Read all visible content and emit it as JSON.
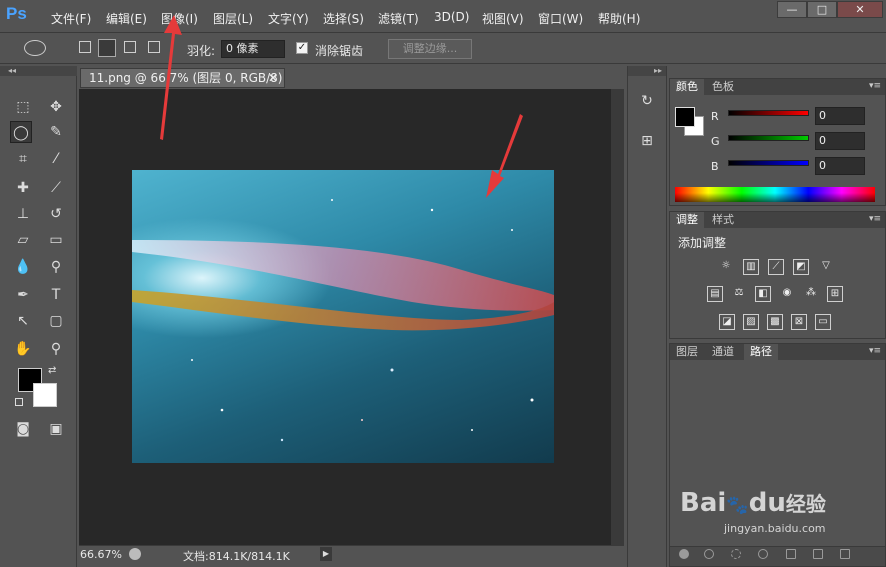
{
  "app": {
    "logo": "Ps"
  },
  "menu": [
    "文件(F)",
    "编辑(E)",
    "图像(I)",
    "图层(L)",
    "文字(Y)",
    "选择(S)",
    "滤镜(T)",
    "3D(D)",
    "视图(V)",
    "窗口(W)",
    "帮助(H)"
  ],
  "window_controls": {
    "minimize": "—",
    "restore": "□",
    "close": "✕"
  },
  "options": {
    "feather_label": "羽化:",
    "feather_value": "0 像素",
    "antialias_label": "消除锯齿",
    "antialias_checked": true,
    "refine_edge_label": "调整边缘..."
  },
  "document": {
    "tab_title": "11.png @ 66.7% (图层 0, RGB/8)",
    "tab_close": "✕",
    "zoom": "66.67%",
    "doc_info": "文档:814.1K/814.1K"
  },
  "color_panel": {
    "tabs": [
      "颜色",
      "色板"
    ],
    "active_tab": "颜色",
    "channels": [
      {
        "label": "R",
        "value": "0",
        "color": "#ff0000"
      },
      {
        "label": "G",
        "value": "0",
        "color": "#00cc00"
      },
      {
        "label": "B",
        "value": "0",
        "color": "#0000ff"
      }
    ],
    "foreground": "#000000",
    "background": "#ffffff"
  },
  "adjustments_panel": {
    "tabs": [
      "调整",
      "样式"
    ],
    "active_tab": "调整",
    "title": "添加调整"
  },
  "layers_panel": {
    "tabs": [
      "图层",
      "通道",
      "路径"
    ],
    "active_tab": "路径"
  },
  "watermark": {
    "text": "Bai",
    "text2": "du",
    "suffix": "经验",
    "url": "jingyan.baidu.com"
  }
}
